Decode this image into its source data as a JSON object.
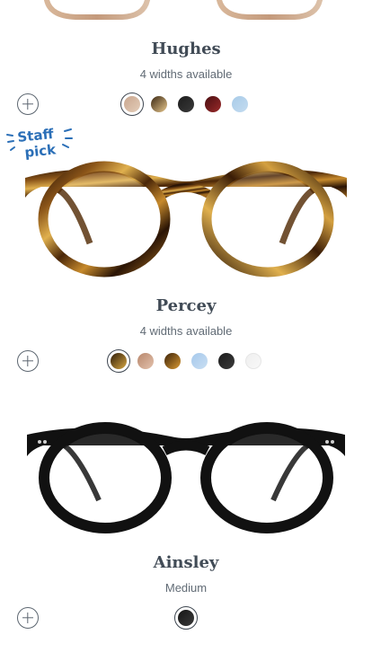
{
  "products": [
    {
      "name": "Hughes",
      "subtitle": "4 widths available",
      "swatches": [
        {
          "name": "light-tortoise",
          "colors": [
            "#c9a68e",
            "#e3cdb9"
          ],
          "selected": true
        },
        {
          "name": "whiskey-tortoise",
          "colors": [
            "#3a2712",
            "#e7c78d"
          ],
          "selected": false
        },
        {
          "name": "jet-black",
          "colors": [
            "#1c1c1c",
            "#3a3a3a"
          ],
          "selected": false
        },
        {
          "name": "burgundy-tortoise",
          "colors": [
            "#4a0e11",
            "#9a2a2a"
          ],
          "selected": false
        },
        {
          "name": "blue",
          "colors": [
            "#a8cbe8",
            "#c4dcf0"
          ],
          "selected": false
        }
      ]
    },
    {
      "name": "Percey",
      "subtitle": "4 widths available",
      "badge": "Staff pick",
      "swatches": [
        {
          "name": "whiskey-tortoise",
          "colors": [
            "#2e1b08",
            "#d7a742"
          ],
          "selected": true
        },
        {
          "name": "rose-tortoise",
          "colors": [
            "#b8876c",
            "#e3c2ad"
          ],
          "selected": false
        },
        {
          "name": "amber-tortoise",
          "colors": [
            "#3c2209",
            "#d99a33"
          ],
          "selected": false
        },
        {
          "name": "sky-blue",
          "colors": [
            "#a6c9ec",
            "#c9def2"
          ],
          "selected": false
        },
        {
          "name": "jet-black",
          "colors": [
            "#1c1c1c",
            "#3a3a3a"
          ],
          "selected": false
        },
        {
          "name": "crystal",
          "colors": [
            "#efefef",
            "#f8f8f8"
          ],
          "selected": false
        }
      ]
    },
    {
      "name": "Ainsley",
      "subtitle": "Medium",
      "swatches": [
        {
          "name": "jet-black",
          "colors": [
            "#151515",
            "#3a3a3a"
          ],
          "selected": true
        }
      ]
    }
  ],
  "colors": {
    "text": "#414b56",
    "subtext": "#616b75",
    "badge_blue": "#2b6fb7",
    "tortoise_dark": "#2a1405",
    "tortoise_mid": "#8a5418",
    "tortoise_light": "#e0b04e",
    "black_frame": "#111111"
  }
}
